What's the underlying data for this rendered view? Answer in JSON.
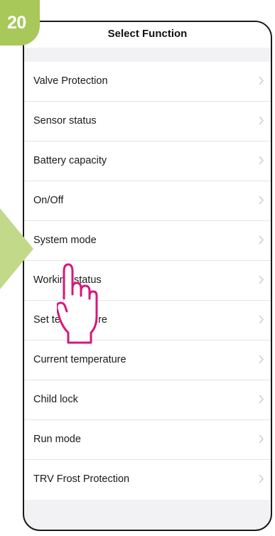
{
  "step_number": "20",
  "header": {
    "title": "Select Function",
    "back_icon": "chevron-left-icon"
  },
  "functions": [
    {
      "label": "Valve Protection"
    },
    {
      "label": "Sensor status"
    },
    {
      "label": "Battery capacity"
    },
    {
      "label": "On/Off"
    },
    {
      "label": "System mode"
    },
    {
      "label": "Working status"
    },
    {
      "label": "Set temperature"
    },
    {
      "label": "Current temperature"
    },
    {
      "label": "Child lock"
    },
    {
      "label": "Run mode"
    },
    {
      "label": "TRV Frost Protection"
    }
  ],
  "colors": {
    "accent_green": "#a8c85a",
    "pointer_magenta": "#d6187a",
    "background_gray": "#f2f2f4"
  }
}
